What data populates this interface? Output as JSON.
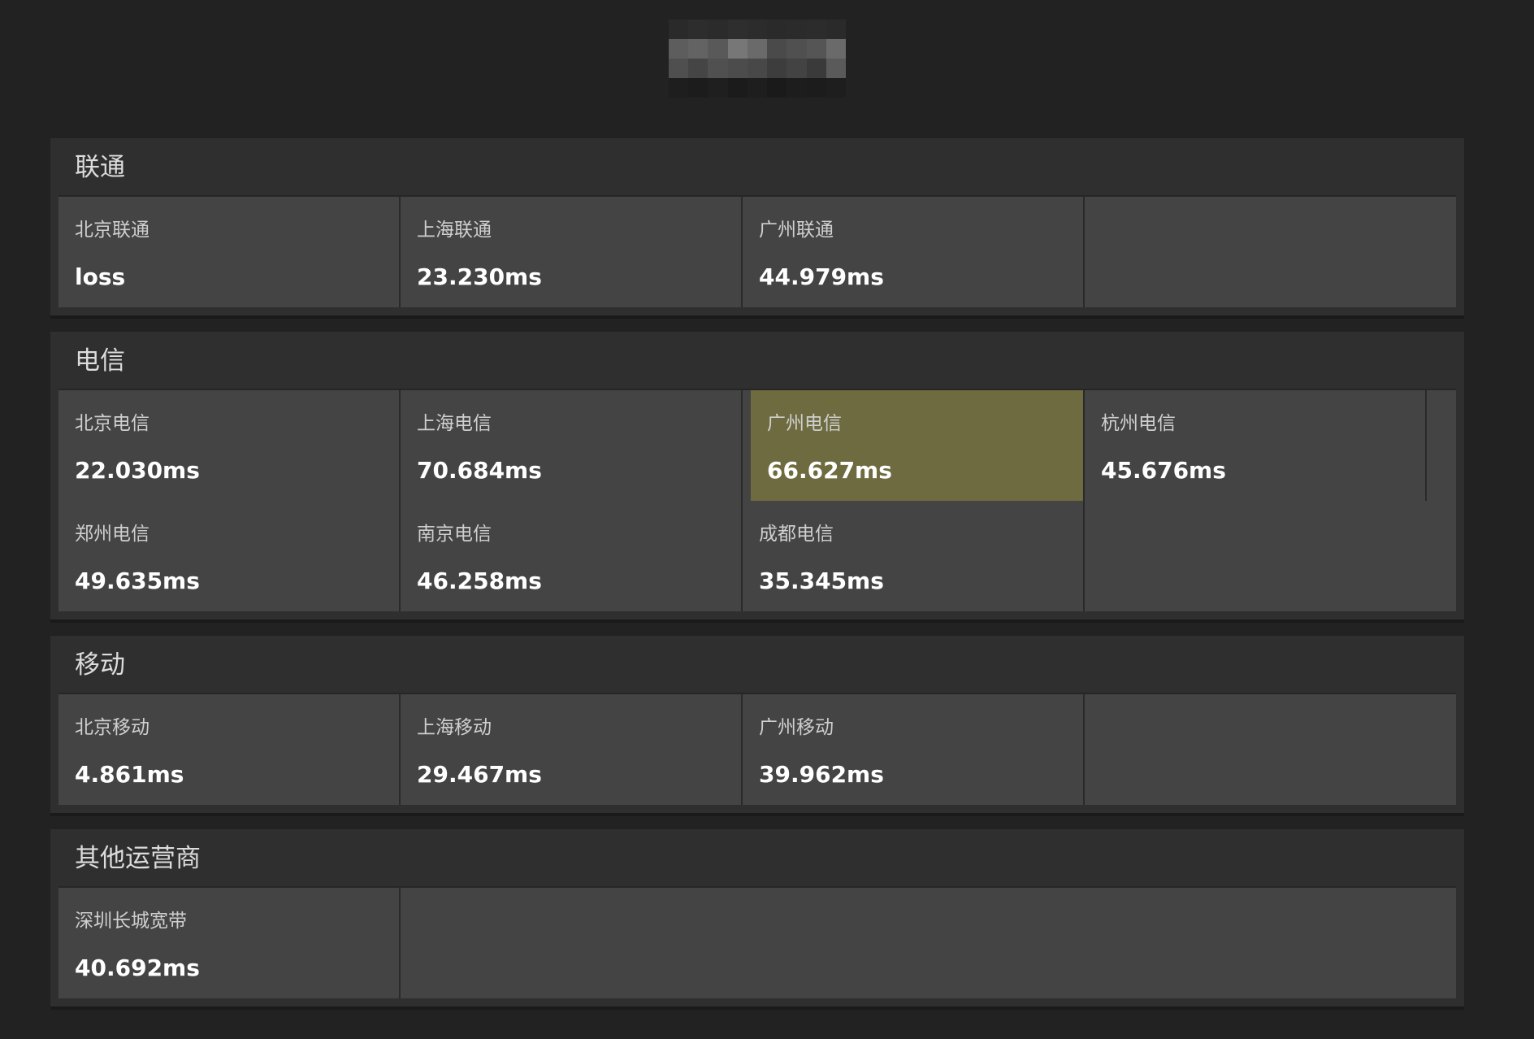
{
  "colors": {
    "background": "#222222",
    "panel": "#2f2f2f",
    "cell": "#444444",
    "highlight": "#6e6b40"
  },
  "logo": {
    "pixels": [
      "#2a2a2a",
      "#2d2d2d",
      "#2b2b2b",
      "#2e2e2e",
      "#2c2c2c",
      "#2a2a2a",
      "#2b2b2b",
      "#2c2c2c",
      "#2a2a2a",
      "#5d5d5d",
      "#636363",
      "#595959",
      "#777777",
      "#6a6a6a",
      "#4a4a4a",
      "#505050",
      "#555555",
      "#6a6a6a",
      "#4f4f4f",
      "#454545",
      "#505050",
      "#4c4c4c",
      "#484848",
      "#3d3d3d",
      "#434343",
      "#3a3a3a",
      "#5a5a5a",
      "#1e1e1e",
      "#1c1c1c",
      "#1f1f1f",
      "#1b1b1b",
      "#1e1e1e",
      "#1a1a1a",
      "#1d1d1d",
      "#1c1c1c",
      "#1e1e1e"
    ]
  },
  "groups": [
    {
      "title": "联通",
      "rows": [
        [
          {
            "name": "北京联通",
            "value": "loss"
          },
          {
            "name": "上海联通",
            "value": "23.230ms"
          },
          {
            "name": "广州联通",
            "value": "44.979ms"
          },
          {
            "name": "",
            "value": ""
          }
        ]
      ]
    },
    {
      "title": "电信",
      "rows": [
        [
          {
            "name": "北京电信",
            "value": "22.030ms"
          },
          {
            "name": "上海电信",
            "value": "70.684ms"
          },
          {
            "name": "广州电信",
            "value": "66.627ms",
            "highlight": true
          },
          {
            "name": "杭州电信",
            "value": "45.676ms"
          }
        ],
        [
          {
            "name": "郑州电信",
            "value": "49.635ms"
          },
          {
            "name": "南京电信",
            "value": "46.258ms"
          },
          {
            "name": "成都电信",
            "value": "35.345ms"
          },
          {
            "name": "",
            "value": ""
          }
        ]
      ]
    },
    {
      "title": "移动",
      "rows": [
        [
          {
            "name": "北京移动",
            "value": "4.861ms"
          },
          {
            "name": "上海移动",
            "value": "29.467ms"
          },
          {
            "name": "广州移动",
            "value": "39.962ms"
          },
          {
            "name": "",
            "value": ""
          }
        ]
      ]
    },
    {
      "title": "其他运营商",
      "rows": [
        [
          {
            "name": "深圳长城宽带",
            "value": "40.692ms"
          }
        ]
      ]
    }
  ]
}
